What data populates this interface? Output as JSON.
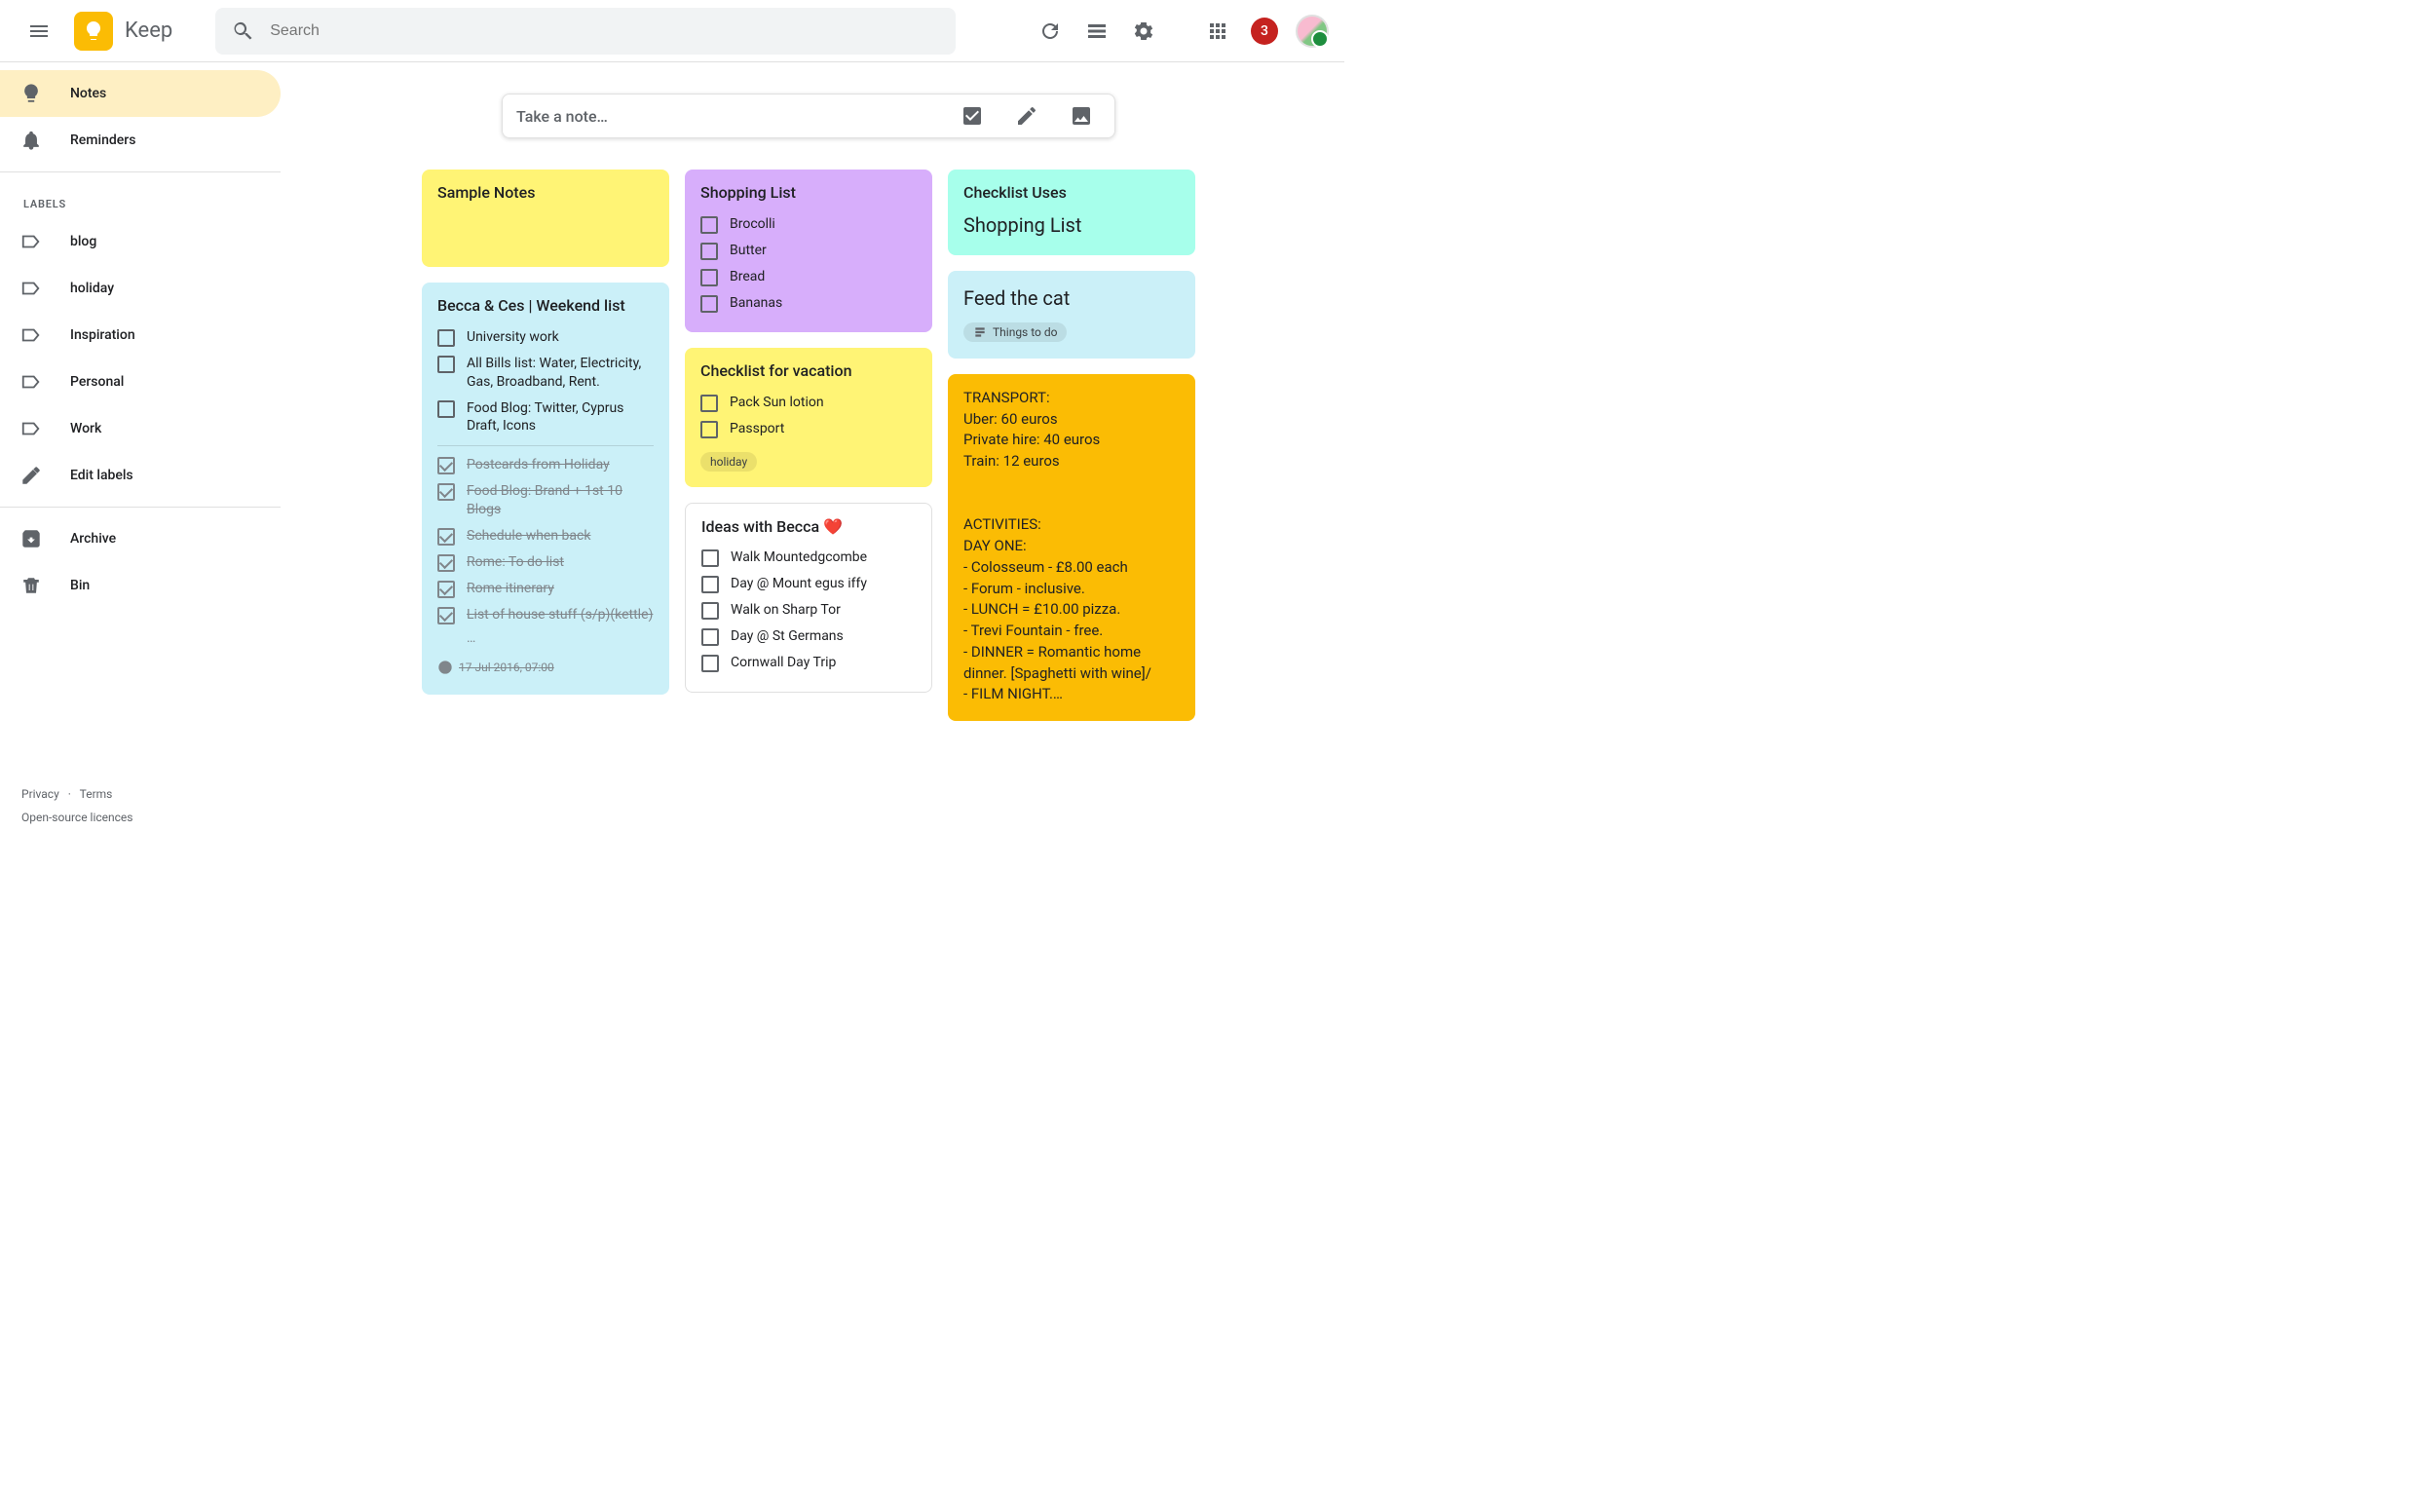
{
  "app": {
    "name": "Keep"
  },
  "search": {
    "placeholder": "Search"
  },
  "badge": {
    "count": "3"
  },
  "sidebar": {
    "notes": "Notes",
    "reminders": "Reminders",
    "labels_heading": "LABELS",
    "labels": [
      {
        "text": "blog"
      },
      {
        "text": "holiday"
      },
      {
        "text": "Inspiration"
      },
      {
        "text": "Personal"
      },
      {
        "text": "Work"
      }
    ],
    "edit_labels": "Edit labels",
    "archive": "Archive",
    "bin": "Bin",
    "footer": {
      "privacy": "Privacy",
      "terms": "Terms",
      "licences": "Open-source licences"
    }
  },
  "take_note": {
    "placeholder": "Take a note…"
  },
  "notes": {
    "col1": {
      "n0": {
        "title": "Sample Notes"
      },
      "n1": {
        "title": "Becca & Ces | Weekend list",
        "items": {
          "i0": "University work",
          "i1": "All Bills list: Water, Electricity, Gas, Broadband, Rent.",
          "i2": "Food Blog: Twitter, Cyprus Draft, Icons"
        },
        "done": {
          "d0": "Postcards from Holiday",
          "d1": "Food Blog: Brand + 1st 10 Blogs",
          "d2": "Schedule when back",
          "d3": "Rome: To do list",
          "d4": "Rome itinerary",
          "d5": "List of house stuff (s/p)(kettle)"
        },
        "more": "…",
        "reminder": "17 Jul 2016, 07:00"
      }
    },
    "col2": {
      "n0": {
        "title": "Shopping List",
        "items": {
          "i0": "Brocolli",
          "i1": "Butter",
          "i2": "Bread",
          "i3": "Bananas"
        }
      },
      "n1": {
        "title": "Checklist for vacation",
        "items": {
          "i0": "Pack Sun lotion",
          "i1": "Passport"
        },
        "chip": "holiday"
      },
      "n2": {
        "title": "Ideas with Becca ❤️",
        "items": {
          "i0": "Walk Mountedgcombe",
          "i1": "Day @ Mount egus iffy",
          "i2": "Walk on Sharp Tor",
          "i3": "Day @ St Germans",
          "i4": "Cornwall Day Trip"
        }
      }
    },
    "col3": {
      "n0": {
        "title": "Checklist Uses",
        "body": "Shopping List"
      },
      "n1": {
        "title": "Feed the cat",
        "chip": "Things to do"
      },
      "n2": {
        "body": "TRANSPORT:\nUber: 60 euros\nPrivate hire: 40 euros\nTrain: 12 euros\n\n\nACTIVITIES:\nDAY ONE:\n- Colosseum - £8.00 each\n- Forum - inclusive.\n- LUNCH = £10.00 pizza.\n- Trevi Fountain - free.\n- DINNER = Romantic home dinner. [Spaghetti with wine]/\n- FILM NIGHT.…"
      }
    }
  }
}
